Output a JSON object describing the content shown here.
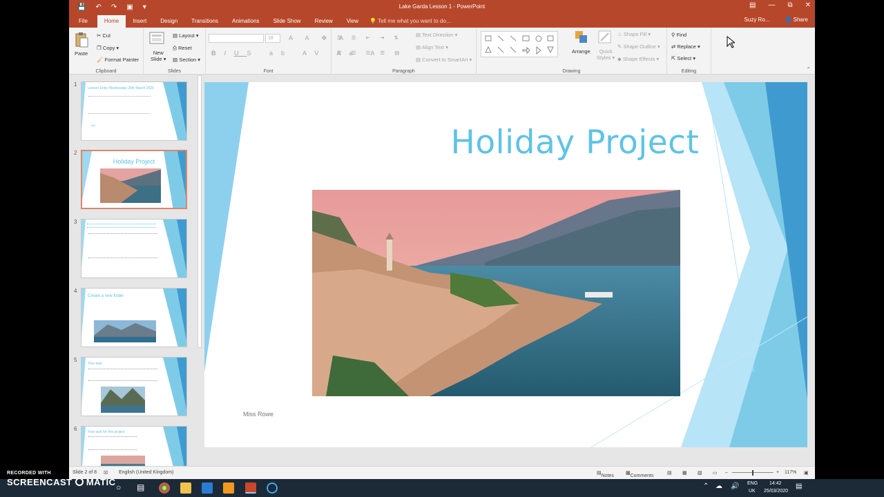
{
  "app": {
    "window_title": "Lake Garda Lesson 1 - PowerPoint",
    "user": "Suzy Ro...",
    "share_label": "Share"
  },
  "tabs": [
    "File",
    "Home",
    "Insert",
    "Design",
    "Transitions",
    "Animations",
    "Slide Show",
    "Review",
    "View"
  ],
  "active_tab": "Home",
  "tell_me": "Tell me what you want to do...",
  "ribbon": {
    "clipboard": {
      "paste": "Paste",
      "cut": "Cut",
      "copy": "Copy",
      "format_painter": "Format Painter",
      "label": "Clipboard"
    },
    "slides": {
      "new_slide_1": "New",
      "new_slide_2": "Slide",
      "layout": "Layout",
      "reset": "Reset",
      "section": "Section",
      "label": "Slides"
    },
    "font": {
      "size": "18",
      "label": "Font"
    },
    "paragraph": {
      "text_direction": "Text Direction",
      "align_text": "Align Text",
      "smartart": "Convert to SmartArt",
      "label": "Paragraph"
    },
    "drawing": {
      "arrange": "Arrange",
      "quick_styles_1": "Quick",
      "quick_styles_2": "Styles",
      "shape_fill": "Shape Fill",
      "shape_outline": "Shape Outline",
      "shape_effects": "Shape Effects",
      "label": "Drawing"
    },
    "editing": {
      "find": "Find",
      "replace": "Replace",
      "select": "Select",
      "label": "Editing"
    }
  },
  "thumbnails": [
    {
      "num": "1",
      "title": "Lesson Entry Wednesday 25th March 2020",
      "caption": "Tutt"
    },
    {
      "num": "2",
      "title": "Holiday Project"
    },
    {
      "num": "3",
      "title": ""
    },
    {
      "num": "4",
      "title": "Create a new folder"
    },
    {
      "num": "5",
      "title": "Your task"
    },
    {
      "num": "6",
      "title": "Your task for this project"
    }
  ],
  "slide": {
    "title": "Holiday Project",
    "subtitle": "Miss Rowe"
  },
  "status": {
    "slide_info": "Slide 2 of 8",
    "language": "English (United Kingdom)",
    "notes": "Notes",
    "comments": "Comments",
    "zoom": "117%"
  },
  "taskbar": {
    "lang_1": "ENG",
    "lang_2": "UK",
    "time": "14:42",
    "date": "25/03/2020"
  },
  "watermark": {
    "line1": "RECORDED WITH",
    "line2": "SCREENCAST",
    "line3": "MATIC"
  },
  "colors": {
    "accent": "#b7472a",
    "title_blue": "#5fc3e4",
    "taskbar": "#1c2a37"
  }
}
